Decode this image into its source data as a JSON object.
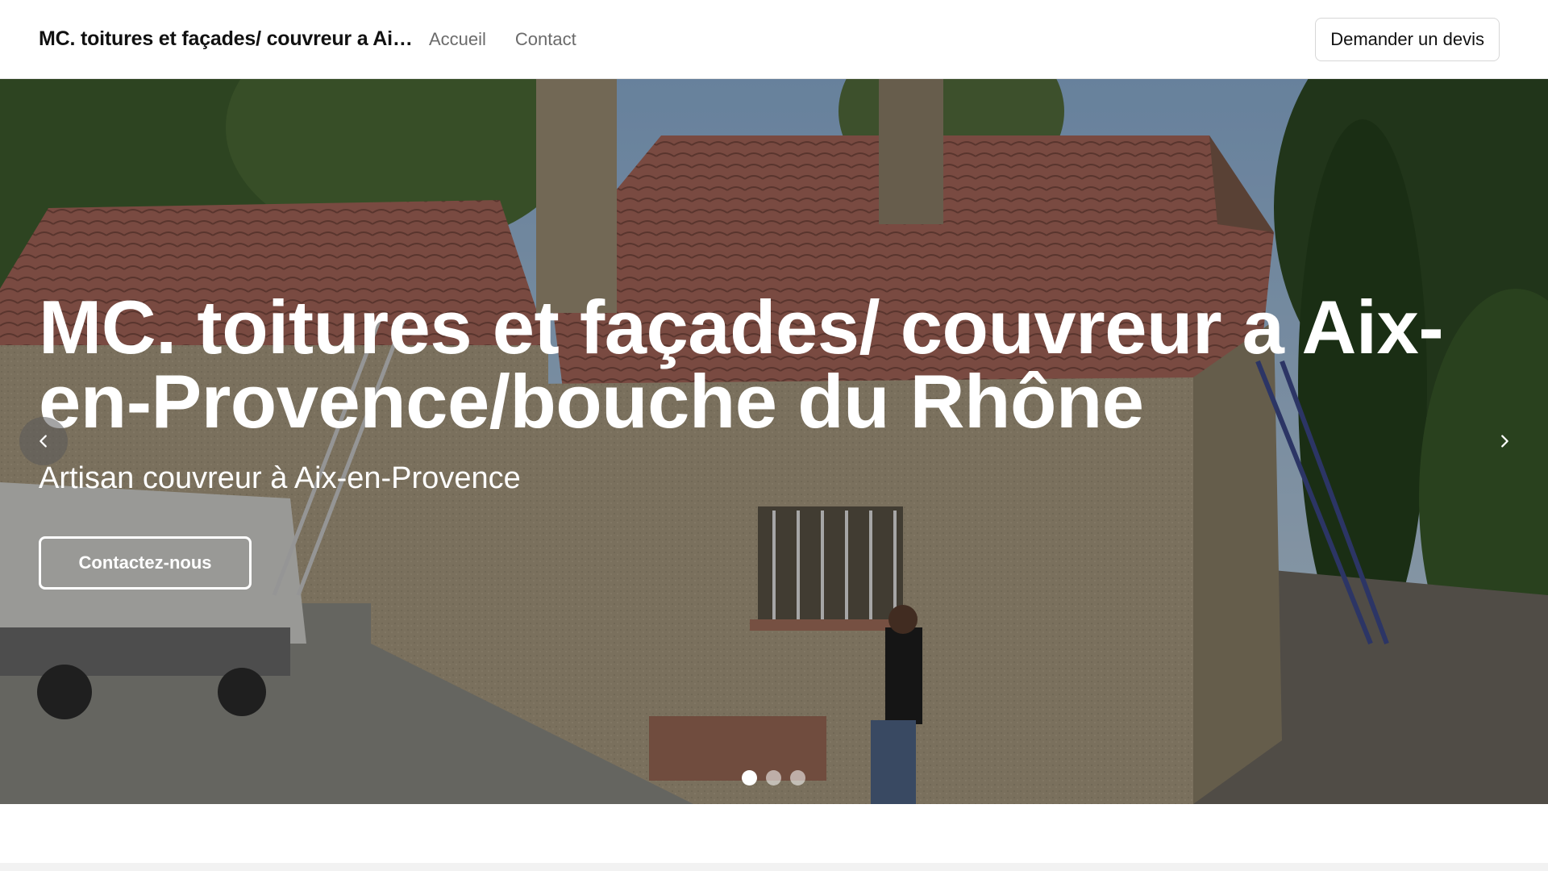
{
  "header": {
    "brand": "MC. toitures et façades/ couvreur a Ai…",
    "nav": [
      {
        "label": "Accueil"
      },
      {
        "label": "Contact"
      }
    ],
    "quote_button": "Demander un devis"
  },
  "hero": {
    "title": "MC. toitures et façades/ couvreur a Aix-en-Provence/bouche du Rhône",
    "subtitle": "Artisan couvreur à Aix-en-Provence",
    "cta": "Contactez-nous",
    "slides": 3,
    "active_slide": 1
  },
  "icons": {
    "prev": "chevron-left-icon",
    "next": "chevron-right-icon"
  },
  "colors": {
    "text": "#111111",
    "nav_muted": "#6b6b6b",
    "hero_text": "#ffffff"
  }
}
